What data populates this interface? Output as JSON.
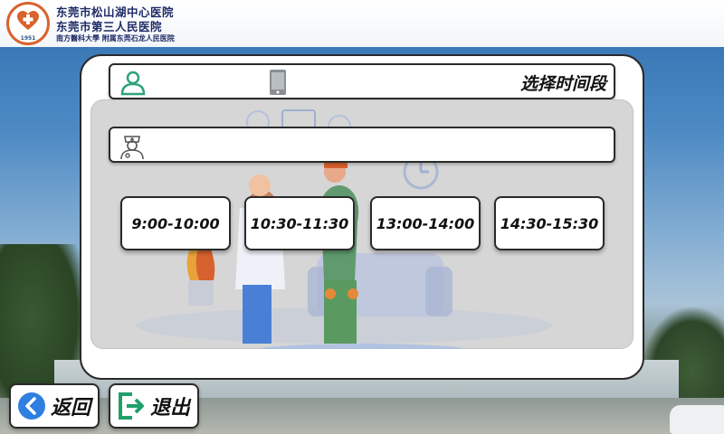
{
  "header": {
    "hospital_name_line1": "东莞市松山湖中心医院",
    "hospital_name_line2": "东莞市第三人民医院",
    "hospital_subtitle": "南方醫科大學 附属东莞石龙人民医院",
    "logo_year": "1951"
  },
  "topbar": {
    "title": "选择时间段",
    "user_icon": "user-icon",
    "tablet_icon": "tablet-icon"
  },
  "doctor_bar": {
    "icon": "doctor-icon",
    "name": ""
  },
  "time_slots": [
    {
      "label": "9:00-10:00"
    },
    {
      "label": "10:30-11:30"
    },
    {
      "label": "13:00-14:00"
    },
    {
      "label": "14:30-15:30"
    }
  ],
  "buttons": {
    "back_label": "返回",
    "exit_label": "退出"
  },
  "colors": {
    "accent_green": "#2fa37a",
    "back_blue": "#2f7fe0",
    "exit_green": "#1fa06a",
    "logo_orange": "#d9632c",
    "header_text": "#1f2b66"
  }
}
